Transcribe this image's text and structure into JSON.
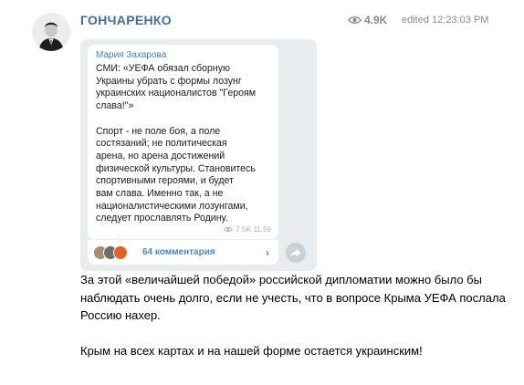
{
  "header": {
    "channel_name": "ГОНЧАРЕНКО",
    "views": "4.9K",
    "edited": "edited 12:23:03 PM"
  },
  "forwarded_screenshot": {
    "author": "Мария Захарова",
    "text": "СМИ: «УЕФА обязал сборную\nУкраины убрать с формы лозунг\nукраинских националистов \"Героям\nслава!\"»\n\nСпорт - не поле боя, а поле\nсостязаний; не политическая\nарена, но арена достижений\nфизической культуры. Становитесь\nспортивными героями, и будет\nвам слава. Именно так, а не\nнационалистическими лозунгами,\nследует прославлять Родину.",
    "views": "7.5K",
    "time": "11:59",
    "comments_label": "64 комментария",
    "colors": {
      "accent": "#4a86c5",
      "background": "#e8ecef"
    }
  },
  "post": {
    "paragraph_1": "За этой «величайшей победой» российской дипломатии можно было бы наблюдать очень долго, если не учесть, что в вопросе Крыма УЕФА послала Россию нахер.",
    "paragraph_2": "Крым на всех картах и на нашей форме остается украинским!"
  },
  "colors": {
    "channel_name": "#3c6fa8",
    "meta": "#8a8a8a"
  }
}
